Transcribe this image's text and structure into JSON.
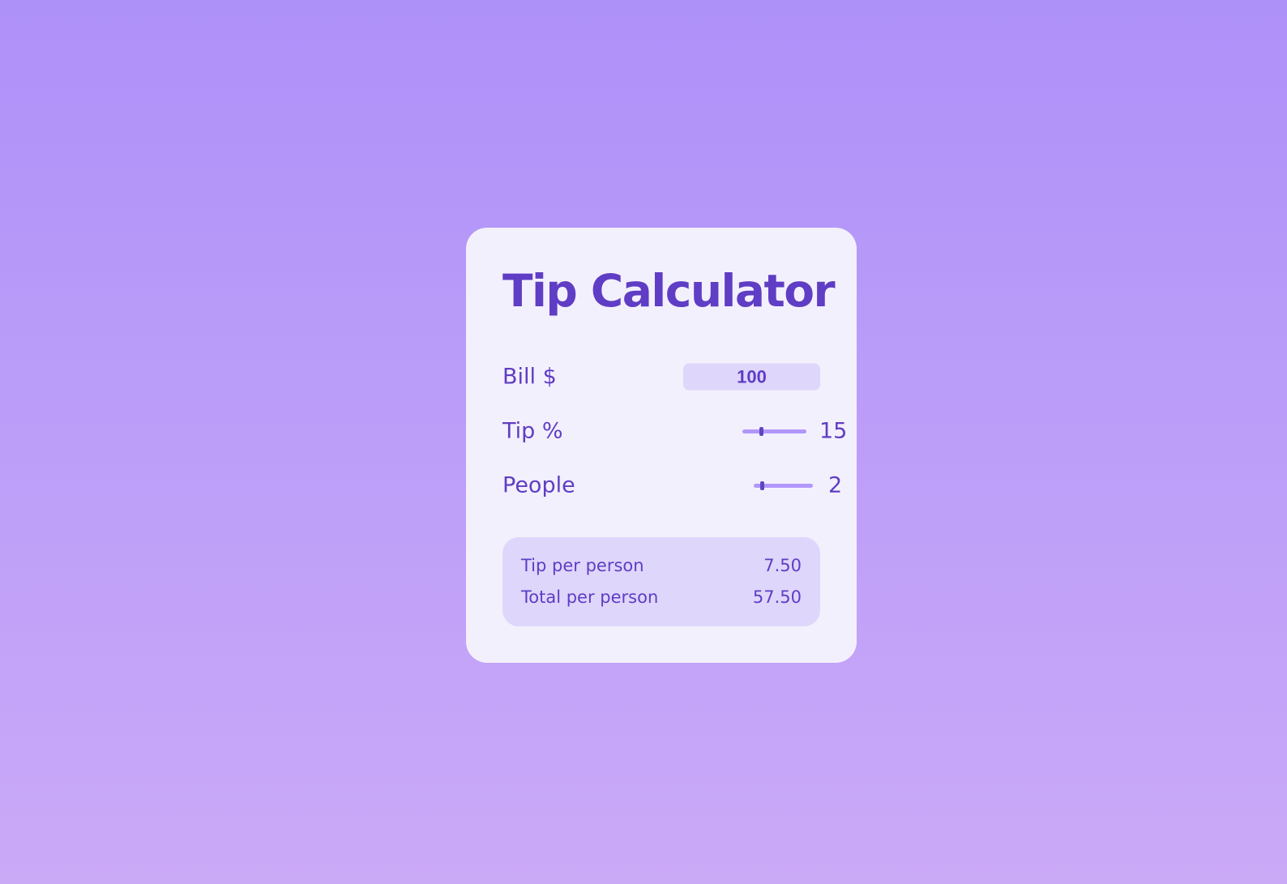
{
  "app": {
    "title": "Tip Calculator"
  },
  "colors": {
    "accent": "#5f3dc4",
    "card_background": "#f3f0fd",
    "field_background": "#ded6fb",
    "slider_track": "#b197fc",
    "page_gradient_top": "#ae90f9",
    "page_gradient_bottom": "#caa9f7"
  },
  "form": {
    "bill": {
      "label": "Bill $",
      "value": "100"
    },
    "tip": {
      "label": "Tip %",
      "value": "15",
      "slider_fraction": 0.3
    },
    "people": {
      "label": "People",
      "value": "2",
      "slider_fraction": 0.15
    }
  },
  "results": {
    "tip_per_person": {
      "label": "Tip per person",
      "value": "7.50"
    },
    "total_per_person": {
      "label": "Total per person",
      "value": "57.50"
    }
  }
}
